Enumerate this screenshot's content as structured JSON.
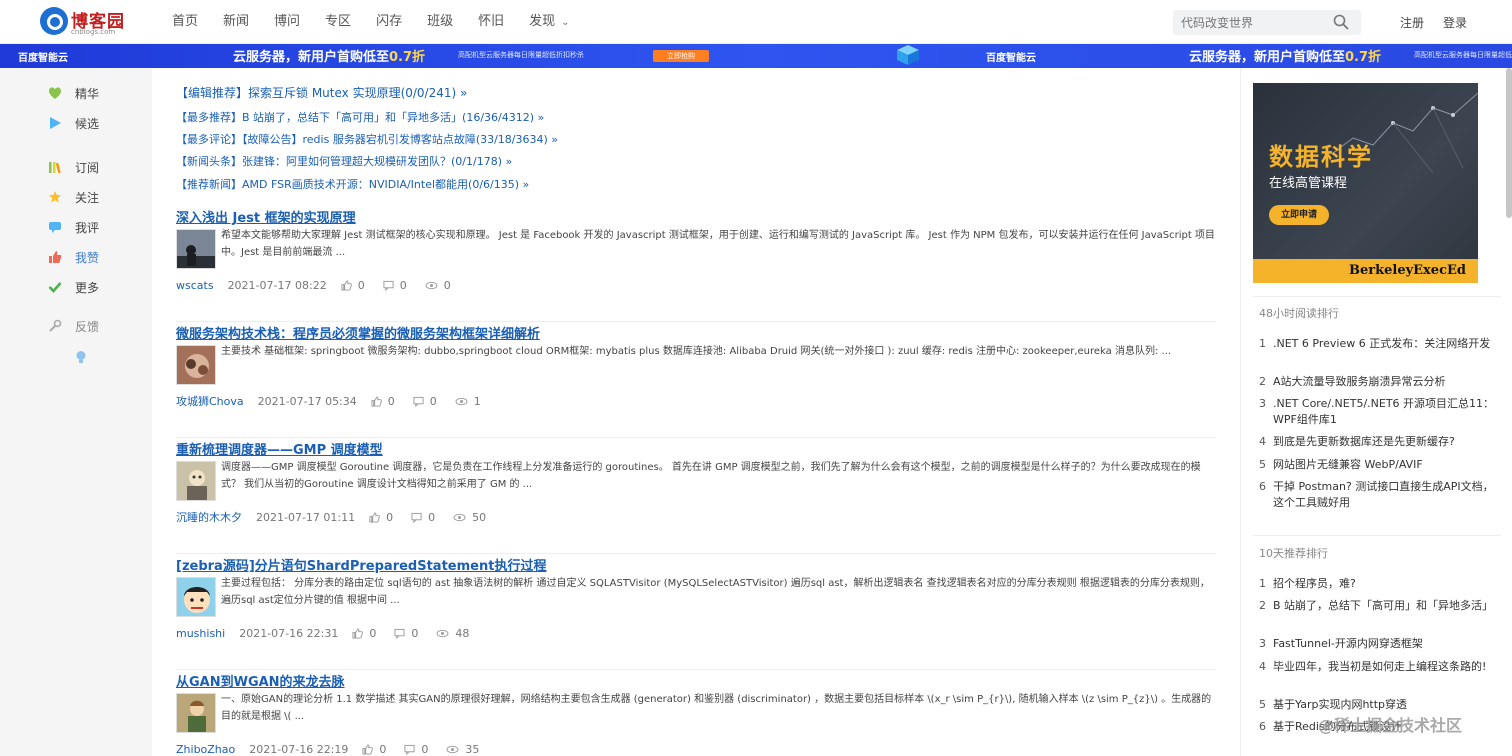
{
  "header": {
    "logo_text": "博客园",
    "logo_sub": "cnblogs.com",
    "nav": [
      "首页",
      "新闻",
      "博问",
      "专区",
      "闪存",
      "班级",
      "怀旧",
      "发现"
    ],
    "search_placeholder": "代码改变世界",
    "register": "注册",
    "login": "登录"
  },
  "banner": {
    "brand": "百度智能云",
    "main_a": "云服务器，新用户首购低至",
    "main_hl": "0.7折",
    "sub": "高配机型云服务器每日限量超低折扣秒杀",
    "btn": "立即抢购"
  },
  "sidebar": {
    "items": [
      {
        "label": "精华",
        "icon": "gem-icon"
      },
      {
        "label": "候选",
        "icon": "play-icon"
      },
      {
        "label": "订阅",
        "icon": "books-icon"
      },
      {
        "label": "关注",
        "icon": "star-icon"
      },
      {
        "label": "我评",
        "icon": "comment-icon"
      },
      {
        "label": "我赞",
        "icon": "thumb-icon"
      },
      {
        "label": "更多",
        "icon": "check-icon"
      }
    ],
    "feedback": "反馈"
  },
  "headlines": [
    "【编辑推荐】探索互斥锁 Mutex 实现原理(0/0/241) »",
    "【最多推荐】B 站崩了，总结下「高可用」和「异地多活」(16/36/4312) »",
    "【最多评论】【故障公告】redis 服务器宕机引发博客站点故障(33/18/3634) »",
    "【新闻头条】张建锋：阿里如何管理超大规模研发团队？(0/1/178) »",
    "【推荐新闻】AMD FSR画质技术开源：NVIDIA/Intel都能用(0/6/135) »"
  ],
  "posts": [
    {
      "title": "深入浅出 Jest 框架的实现原理",
      "summary": "希望本文能够帮助大家理解 Jest 测试框架的核心实现和原理。 Jest 是 Facebook 开发的 Javascript 测试框架，用于创建、运行和编写测试的 JavaScript 库。 Jest 作为 NPM 包发布，可以安装并运行在任何 JavaScript 项目中。Jest 是目前前端最流 ...",
      "author": "wscats",
      "date": "2021-07-17 08:22",
      "likes": "0",
      "comments": "0",
      "views": "0"
    },
    {
      "title": "微服务架构技术栈：程序员必须掌握的微服务架构框架详细解析",
      "summary": "主要技术 基础框架: springboot 微服务架构: dubbo,springboot cloud ORM框架: mybatis plus 数据库连接池: Alibaba Druid 网关(统一对外接口 ): zuul 缓存: redis 注册中心: zookeeper,eureka 消息队列: ...",
      "author": "攻城狮Chova",
      "date": "2021-07-17 05:34",
      "likes": "0",
      "comments": "0",
      "views": "1"
    },
    {
      "title": "重新梳理调度器——GMP 调度模型",
      "summary": "调度器——GMP 调度模型 Goroutine 调度器，它是负责在工作线程上分发准备运行的 goroutines。 首先在讲 GMP 调度模型之前，我们先了解为什么会有这个模型，之前的调度模型是什么样子的？为什么要改成现在的模式？ 我们从当初的Goroutine 调度设计文档得知之前采用了 GM 的 ...",
      "author": "沉睡的木木夕",
      "date": "2021-07-17 01:11",
      "likes": "0",
      "comments": "0",
      "views": "50"
    },
    {
      "title": "[zebra源码]分片语句ShardPreparedStatement执行过程",
      "summary": "主要过程包括： 分库分表的路由定位 sql语句的 ast 抽象语法树的解析 通过自定义 SQLASTVisitor (MySQLSelectASTVisitor) 遍历sql ast，解析出逻辑表名 查找逻辑表名对应的分库分表规则 根据逻辑表的分库分表规则，遍历sql ast定位分片键的值 根据中间 ...",
      "author": "mushishi",
      "date": "2021-07-16 22:31",
      "likes": "0",
      "comments": "0",
      "views": "48"
    },
    {
      "title": "从GAN到WGAN的来龙去脉",
      "summary": "一、原始GAN的理论分析 1.1 数学描述 其实GAN的原理很好理解，网络结构主要包含生成器 (generator) 和鉴别器 (discriminator) ，数据主要包括目标样本 \\(x_r \\sim P_{r}\\), 随机输入样本 \\(z \\sim P_{z}\\) 。生成器的目的就是根据 \\( ...",
      "author": "ZhiboZhao",
      "date": "2021-07-16 22:19",
      "likes": "0",
      "comments": "0",
      "views": "35"
    }
  ],
  "ad": {
    "title": "数据科学",
    "sub": "在线高管课程",
    "btn": "立即申请",
    "foot": "BerkeleyExecEd"
  },
  "rank48": {
    "title": "48小时阅读排行",
    "items": [
      ".NET 6 Preview 6 正式发布：关注网络开发",
      "A站大流量导致服务崩溃异常云分析",
      ".NET Core/.NET5/.NET6 开源项目汇总11：WPF组件库1",
      "到底是先更新数据库还是先更新缓存?",
      "网站图片无缝兼容 WebP/AVIF",
      "干掉 Postman? 测试接口直接生成API文档，这个工具贼好用"
    ]
  },
  "rank10": {
    "title": "10天推荐排行",
    "items": [
      "招个程序员，难?",
      "B 站崩了，总结下「高可用」和「异地多活」",
      "FastTunnel-开源内网穿透框架",
      "毕业四年，我当初是如何走上编程这条路的!",
      "基于Yarp实现内网http穿透",
      "基于Redis的分布式锁设计"
    ]
  },
  "watermark": "@稀土掘金技术社区"
}
